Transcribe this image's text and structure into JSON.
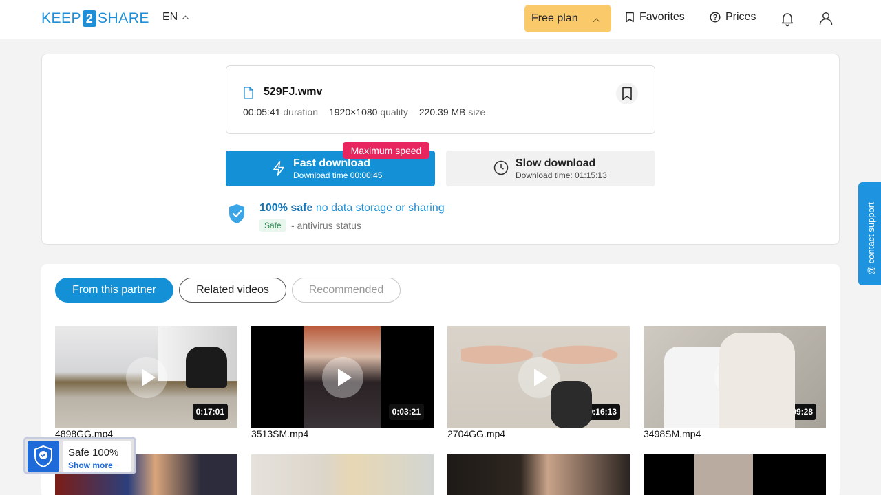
{
  "header": {
    "logo_left": "KEEP",
    "logo_mid": "2",
    "logo_right": "SHARE",
    "lang": "EN",
    "plan": "Free plan",
    "favorites": "Favorites",
    "prices": "Prices"
  },
  "file": {
    "name": "529FJ.wmv",
    "duration_value": "00:05:41",
    "duration_label": "duration",
    "quality_value": "1920×1080",
    "quality_label": "quality",
    "size_value": "220.39 MB",
    "size_label": "size"
  },
  "download": {
    "badge": "Maximum speed",
    "fast_title": "Fast download",
    "fast_sub": "Download time 00:00:45",
    "slow_title": "Slow download",
    "slow_sub": "Download time: 01:15:13"
  },
  "safety": {
    "bold": "100% safe",
    "rest": " no data storage or sharing",
    "tag": "Safe",
    "status": "- antivirus status"
  },
  "tabs": [
    "From this partner",
    "Related videos",
    "Recommended"
  ],
  "videos": [
    {
      "name": "4898GG.mp4",
      "duration": "0:17:01"
    },
    {
      "name": "3513SM.mp4",
      "duration": "0:03:21"
    },
    {
      "name": "2704GG.mp4",
      "duration": "0:16:13"
    },
    {
      "name": "3498SM.mp4",
      "duration": "0:09:28"
    }
  ],
  "contact": "@ contact support",
  "widget": {
    "title": "Safe 100%",
    "link": "Show more"
  },
  "colors": {
    "primary": "#1390d6",
    "plan": "#f9c96a",
    "badge": "#e8255f"
  }
}
